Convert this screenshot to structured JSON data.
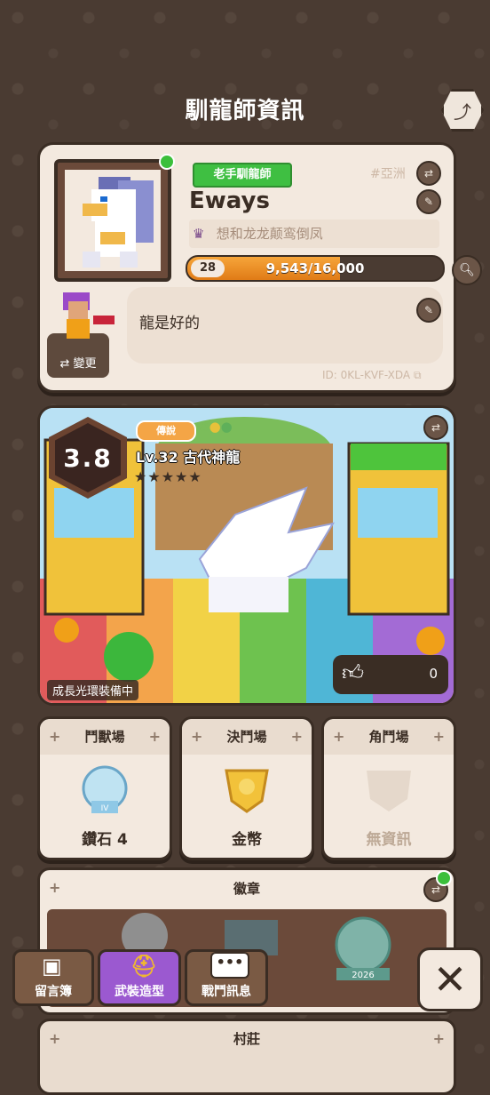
{
  "header": {
    "title": "馴龍師資訊",
    "share_icon": "share-icon"
  },
  "profile": {
    "rank_badge": "老手馴龍師",
    "region": "#亞洲",
    "name": "Eways",
    "clan_name": "想和龙龙颠鸾倒凤",
    "level": "28",
    "xp_text": "9,543/16,000",
    "xp_fraction": 0.596,
    "bio": "龍是好的",
    "change_label": "變更",
    "id_text": "ID: 0KL-KVF-XDA"
  },
  "showcase": {
    "score": "3.8",
    "rarity": "傳說",
    "pet_name": "Lv.32 古代神龍",
    "stars": "★★★★★",
    "aura_status": "成長光環裝備中",
    "likes": "0"
  },
  "arenas": [
    {
      "title": "鬥獸場",
      "value": "鑽石 4",
      "badge_text": "IV"
    },
    {
      "title": "決鬥場",
      "value": "金幣"
    },
    {
      "title": "角鬥場",
      "value": "無資訊"
    }
  ],
  "badges": {
    "title": "徽章",
    "badge_year": "2026"
  },
  "village": {
    "title": "村莊"
  },
  "bottom_tabs": [
    {
      "label": "留言簿"
    },
    {
      "label": "武裝造型"
    },
    {
      "label": "戰鬥訊息"
    }
  ]
}
